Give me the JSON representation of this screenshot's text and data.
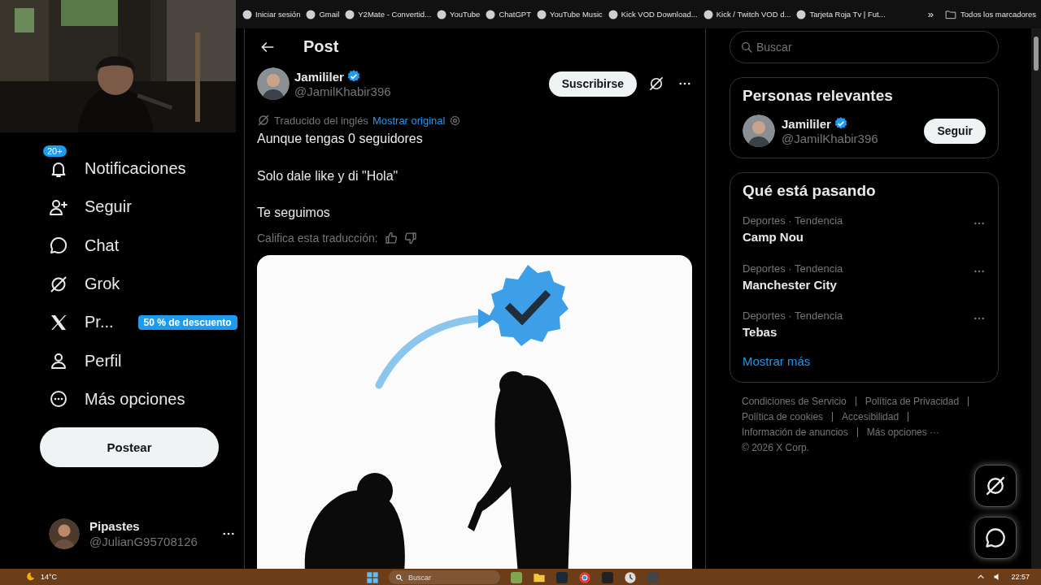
{
  "bookmarks": {
    "items": [
      {
        "label": "Iniciar sesión"
      },
      {
        "label": "Gmail"
      },
      {
        "label": "Y2Mate - Convertid..."
      },
      {
        "label": "YouTube"
      },
      {
        "label": "ChatGPT"
      },
      {
        "label": "YouTube Music"
      },
      {
        "label": "Kick VOD Download..."
      },
      {
        "label": "Kick / Twitch VOD d..."
      },
      {
        "label": "Tarjeta Roja Tv | Fut..."
      }
    ],
    "overflow": "»",
    "all": "Todos los marcadores"
  },
  "sidebar": {
    "items": [
      {
        "kind": "bell",
        "label": "Notificaciones",
        "badge": "20+"
      },
      {
        "kind": "follow",
        "label": "Seguir"
      },
      {
        "kind": "chat",
        "label": "Chat"
      },
      {
        "kind": "grok",
        "label": "Grok"
      },
      {
        "kind": "x",
        "label": "Pr...",
        "promo": "50 % de descuento"
      },
      {
        "kind": "profile",
        "label": "Perfil"
      },
      {
        "kind": "more",
        "label": "Más opciones"
      }
    ],
    "post_button": "Postear",
    "account": {
      "name": "Pipastes",
      "handle": "@JulianG95708126"
    }
  },
  "post": {
    "title": "Post",
    "author": {
      "name": "Jamililer",
      "verified": true,
      "handle": "@JamilKhabir396"
    },
    "subscribe": "Suscribirse",
    "translated": "Traducido del inglés",
    "show_original": "Mostrar original",
    "paragraphs": [
      "Aunque tengas 0 seguidores",
      "Solo dale like y di \"Hola\"",
      "Te seguimos"
    ],
    "rate": "Califica esta traducción:"
  },
  "aside": {
    "search": {
      "placeholder": "Buscar"
    },
    "relevant": {
      "title": "Personas relevantes",
      "people": [
        {
          "name": "Jamililer",
          "verified": true,
          "handle": "@JamilKhabir396",
          "button": "Seguir"
        }
      ]
    },
    "trends": {
      "title": "Qué está pasando",
      "items": [
        {
          "context": "Deportes · Tendencia",
          "name": "Camp Nou"
        },
        {
          "context": "Deportes · Tendencia",
          "name": "Manchester City"
        },
        {
          "context": "Deportes · Tendencia",
          "name": "Tebas"
        }
      ],
      "show_more": "Mostrar más"
    },
    "footer": {
      "lines": [
        [
          "Condiciones de Servicio",
          "Política de Privacidad"
        ],
        [
          "Política de cookies",
          "Accesibilidad"
        ],
        [
          "Información de anuncios",
          "Más opciones ···"
        ]
      ],
      "copyright": "© 2026 X Corp."
    }
  },
  "taskbar": {
    "weather": "14°C",
    "search": "Buscar",
    "time": "22:57"
  }
}
